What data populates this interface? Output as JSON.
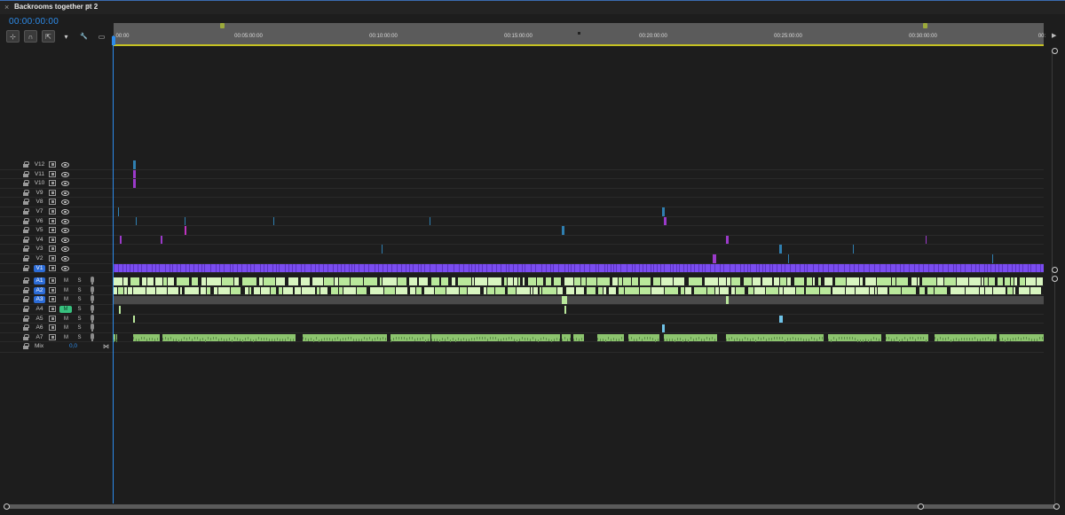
{
  "panel": {
    "tab_close": "×",
    "title": "Backrooms together pt 2",
    "menu": "≡",
    "timecode": "00:00:00:00"
  },
  "tools": [
    {
      "icon": "snap-icon",
      "glyph": "⊹"
    },
    {
      "icon": "linked-selection-icon",
      "glyph": "∩"
    },
    {
      "icon": "nest-icon",
      "glyph": "⇱"
    },
    {
      "icon": "marker-icon",
      "glyph": "▾"
    },
    {
      "icon": "wrench-icon",
      "glyph": "🔧"
    },
    {
      "icon": "captions-icon",
      "glyph": "▭"
    }
  ],
  "ruler": {
    "ticks": [
      "00:00",
      "00:05:00:00",
      "00:10:00:00",
      "00:15:00:00",
      "00:20:00:00",
      "00:25:00:00",
      "00:30:00:00",
      "00:"
    ],
    "marker_color": "#9caa3b"
  },
  "video_tracks": [
    "V12",
    "V11",
    "V10",
    "V9",
    "V8",
    "V7",
    "V6",
    "V5",
    "V4",
    "V3",
    "V2",
    "V1"
  ],
  "audio_tracks": [
    {
      "name": "A1",
      "m": "M",
      "s": "S",
      "active": true,
      "muted": false
    },
    {
      "name": "A2",
      "m": "M",
      "s": "S",
      "active": true,
      "muted": false
    },
    {
      "name": "A3",
      "m": "M",
      "s": "S",
      "active": true,
      "muted": false
    },
    {
      "name": "A4",
      "m": "M",
      "s": "S",
      "active": false,
      "muted": true
    },
    {
      "name": "A5",
      "m": "M",
      "s": "S",
      "active": false,
      "muted": false
    },
    {
      "name": "A6",
      "m": "M",
      "s": "S",
      "active": false,
      "muted": false
    },
    {
      "name": "A7",
      "m": "M",
      "s": "S",
      "active": false,
      "muted": false
    }
  ],
  "mix": {
    "label": "Mix",
    "value": "0,0"
  },
  "colors": {
    "playhead": "#2d8ceb",
    "video_clip": "#7a4cf0",
    "audio_clip": "#b9e89b",
    "audio_clip_dark": "#8cc46e",
    "accent_marker": "#c6c223"
  }
}
